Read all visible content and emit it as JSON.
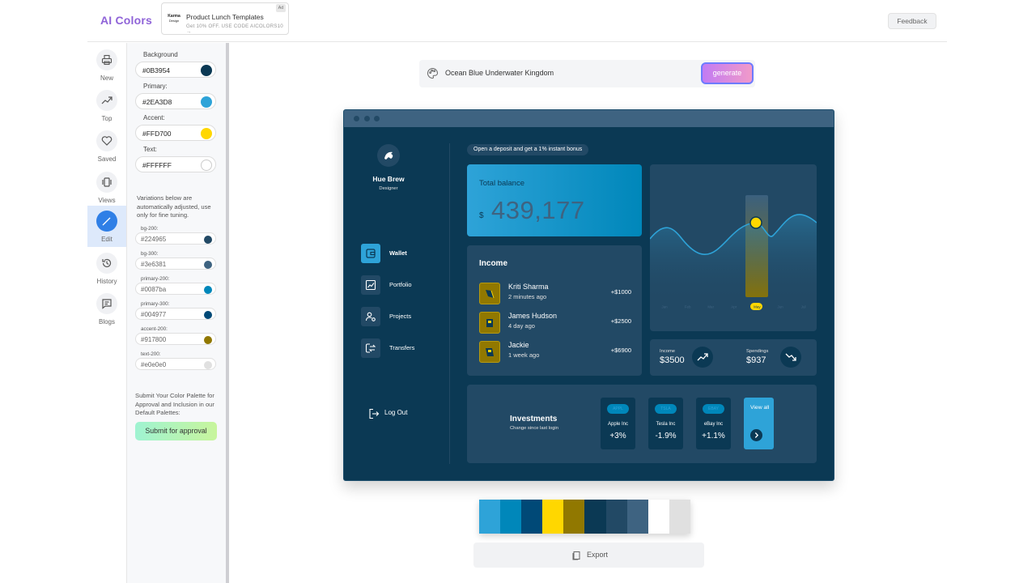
{
  "header": {
    "brand": "AI Colors",
    "ad": {
      "logo_line1": "Karma",
      "logo_line2": "Design",
      "title": "Product Lunch Templates",
      "subtitle": "Get 10% OFF. USE CODE AICOLORS10 →",
      "badge": "Ad"
    },
    "feedback_label": "Feedback"
  },
  "nav": {
    "items": [
      {
        "label": "New",
        "icon": "print-icon"
      },
      {
        "label": "Top",
        "icon": "trending-up-icon"
      },
      {
        "label": "Saved",
        "icon": "heart-icon"
      },
      {
        "label": "Views",
        "icon": "carousel-icon"
      },
      {
        "label": "Edit",
        "icon": "pencil-icon",
        "active": true
      },
      {
        "label": "History",
        "icon": "history-icon"
      },
      {
        "label": "Blogs",
        "icon": "chat-icon"
      }
    ]
  },
  "editor": {
    "colors": [
      {
        "label": "Background",
        "value": "#0B3954",
        "color": "#0B3954"
      },
      {
        "label": "Primary:",
        "value": "#2EA3D8",
        "color": "#2EA3D8"
      },
      {
        "label": "Accent:",
        "value": "#FFD700",
        "color": "#FFD700"
      },
      {
        "label": "Text:",
        "value": "#FFFFFF",
        "color": "#FFFFFF"
      }
    ],
    "variations_note": "Variations below are automatically adjusted, use only for fine tuning.",
    "variations": [
      {
        "label": "bg-200:",
        "value": "#224965",
        "color": "#224965"
      },
      {
        "label": "bg-300:",
        "value": "#3e6381",
        "color": "#3e6381"
      },
      {
        "label": "primary-200:",
        "value": "#0087ba",
        "color": "#0087ba"
      },
      {
        "label": "primary-300:",
        "value": "#004977",
        "color": "#004977"
      },
      {
        "label": "accent-200:",
        "value": "#917800",
        "color": "#917800"
      },
      {
        "label": "text-200:",
        "value": "#e0e0e0",
        "color": "#e0e0e0"
      }
    ],
    "submit_note": "Submit Your Color Palette for Approval and Inclusion in our Default Palettes:",
    "submit_label": "Submit for approval"
  },
  "prompt": {
    "value": "Ocean Blue Underwater Kingdom",
    "generate_label": "generate"
  },
  "preview": {
    "profile": {
      "name": "Hue Brew",
      "role": "Designer"
    },
    "nav": [
      {
        "label": "Wallet",
        "icon": "wallet-icon",
        "active": true
      },
      {
        "label": "Portfolio",
        "icon": "chart-line-icon"
      },
      {
        "label": "Projects",
        "icon": "user-gear-icon"
      },
      {
        "label": "Transfers",
        "icon": "transfer-icon"
      }
    ],
    "logout_label": "Log Out",
    "promo": "Open a deposit and get a 1% instant bonus",
    "balance": {
      "title": "Total balance",
      "currency": "$",
      "amount": "439,177"
    },
    "income": {
      "title": "Income",
      "rows": [
        {
          "name": "Kriti Sharma",
          "time": "2 minutes ago",
          "amount": "+$1000"
        },
        {
          "name": "James Hudson",
          "time": "4 day ago",
          "amount": "+$2500"
        },
        {
          "name": "Jackie",
          "time": "1 week ago",
          "amount": "+$6900"
        }
      ]
    },
    "chart": {
      "months": [
        "Jan",
        "Feb",
        "Mar",
        "Apr",
        "May",
        "Jun",
        "Jul"
      ],
      "highlight_month": "May"
    },
    "summary": {
      "income_label": "Income",
      "income_value": "$3500",
      "spend_label": "Spendings",
      "spend_value": "$937"
    },
    "investments": {
      "title": "Investments",
      "subtitle": "Change since last login",
      "stocks": [
        {
          "ticker": "APPL",
          "name": "Apple Inc",
          "change": "+3%"
        },
        {
          "ticker": "TSLA",
          "name": "Tesla Inc",
          "change": "-1.9%"
        },
        {
          "ticker": "EBAY",
          "name": "eBay Inc",
          "change": "+1.1%"
        }
      ],
      "view_all": "View all"
    }
  },
  "swatches": [
    {
      "color": "#2EA3D8",
      "weight": 1.05
    },
    {
      "color": "#0087ba",
      "weight": 1.05
    },
    {
      "color": "#004977",
      "weight": 1.05
    },
    {
      "color": "#FFD700",
      "weight": 1.05
    },
    {
      "color": "#917800",
      "weight": 1.05
    },
    {
      "color": "#0B3954",
      "weight": 1.05
    },
    {
      "color": "#224965",
      "weight": 1.05
    },
    {
      "color": "#3e6381",
      "weight": 1.05
    },
    {
      "color": "#FFFFFF",
      "weight": 1.05
    },
    {
      "color": "#e0e0e0",
      "weight": 1.05
    }
  ],
  "export_label": "Export"
}
